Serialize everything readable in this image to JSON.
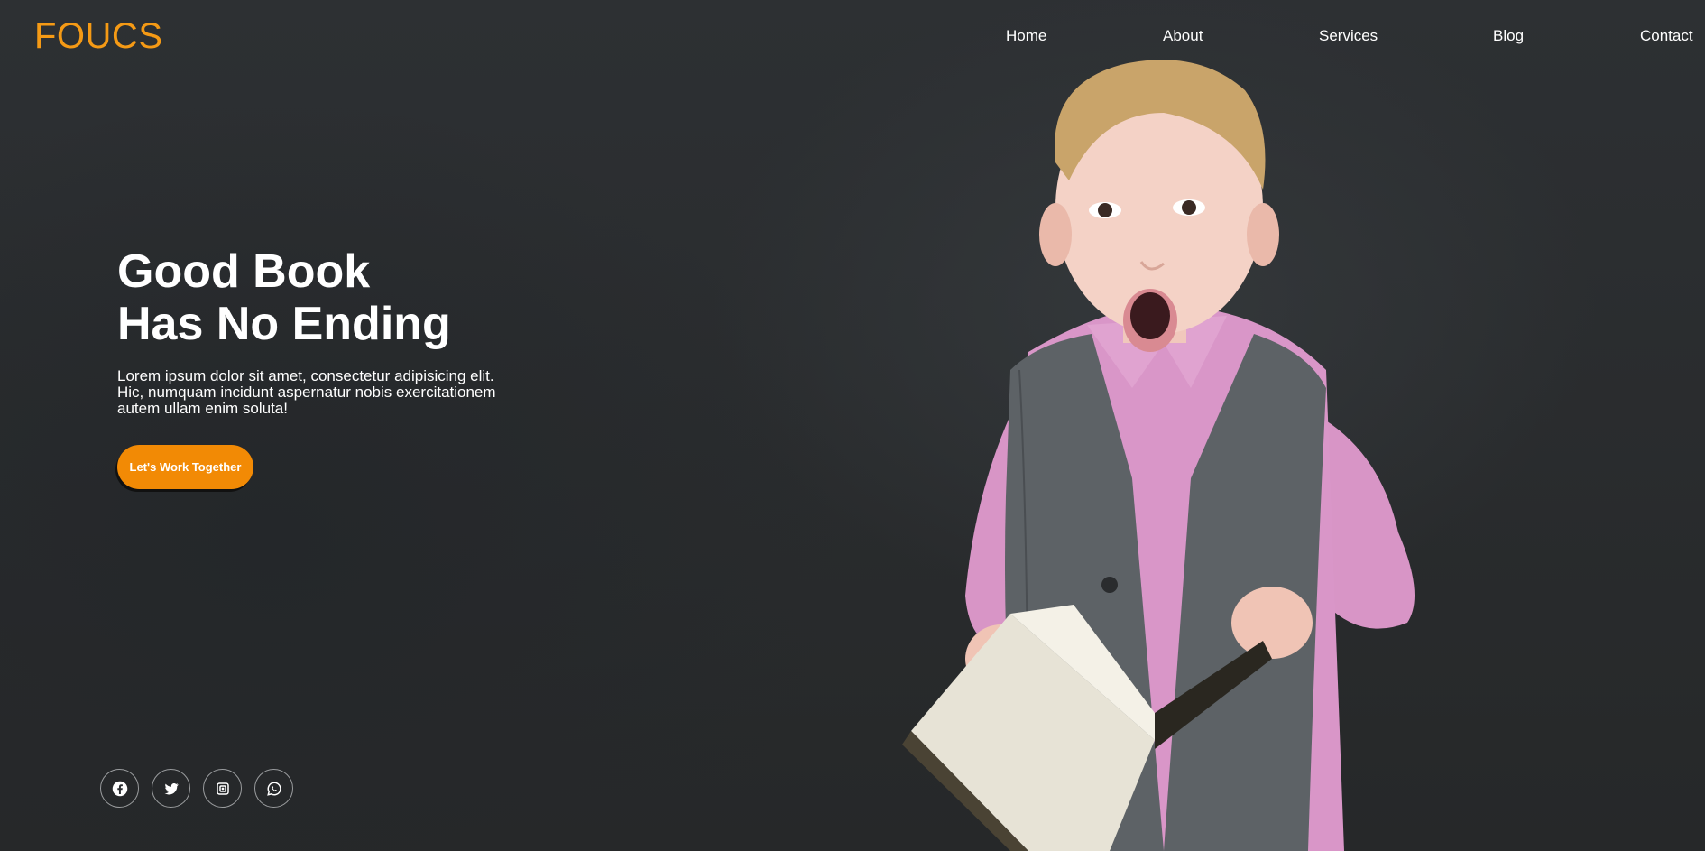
{
  "brand": {
    "logo": "FOUCS",
    "accent": "#f59a15"
  },
  "nav": [
    "Home",
    "About",
    "Services",
    "Blog",
    "Contact"
  ],
  "hero": {
    "title_line1": "Good Book",
    "title_line2": "Has No Ending",
    "text": "Lorem ipsum dolor sit amet, consectetur adipisicing elit. Hic, numquam incidunt aspernatur nobis exercitationem autem ullam enim soluta!",
    "cta_label": "Let's Work Together",
    "cta_color": "#f28a05"
  },
  "social": [
    "facebook-icon",
    "twitter-icon",
    "instagram-icon",
    "whatsapp-icon"
  ]
}
